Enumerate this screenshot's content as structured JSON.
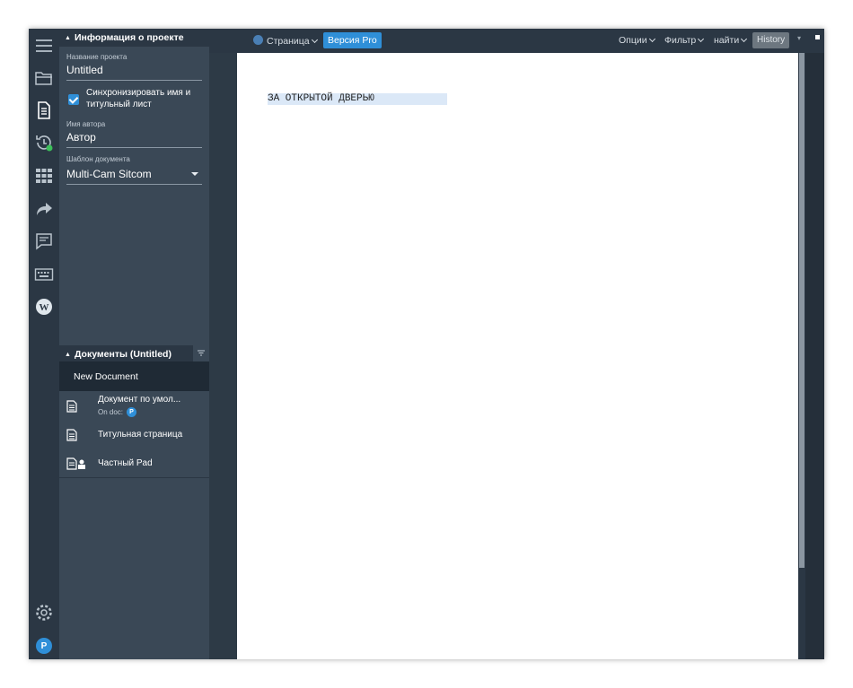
{
  "rail": {
    "icons": [
      "menu-icon",
      "folder-icon",
      "document-icon",
      "history-icon",
      "grid-icon",
      "share-icon",
      "comment-icon",
      "keyboard-icon",
      "wordpress-icon",
      "gear-icon"
    ],
    "avatar_letter": "P"
  },
  "project_info": {
    "header": "Информация о проекте",
    "name_label": "Название проекта",
    "name_value": "Untitled",
    "sync_label": "Синхронизировать имя и титульный лист",
    "sync_checked": true,
    "author_label": "Имя автора",
    "author_value": "Автор",
    "template_label": "Шаблон документа",
    "template_value": "Multi-Cam Sitcom"
  },
  "documents": {
    "header": "Документы  (Untitled)",
    "new_document": "New Document",
    "items": [
      {
        "name": "Документ по умол...",
        "sub": "On doc:",
        "badge": "P",
        "icon": "document-icon"
      },
      {
        "name": "Титульная страница",
        "icon": "document-icon"
      },
      {
        "name": "Частный Pad",
        "icon": "private-pad-icon"
      }
    ]
  },
  "topbar": {
    "page_label": "Страница",
    "pro_label": "Версия Pro",
    "options_label": "Опции",
    "filter_label": "Фильтр",
    "find_label": "найти",
    "history_label": "History"
  },
  "editor": {
    "first_line": "ЗА ОТКРЫТОЙ ДВЕРЬЮ"
  },
  "colors": {
    "rail_bg": "#2b3744",
    "panel_bg": "#3a4856",
    "accent": "#2f8fd8",
    "selected_row": "#1f2a35"
  }
}
